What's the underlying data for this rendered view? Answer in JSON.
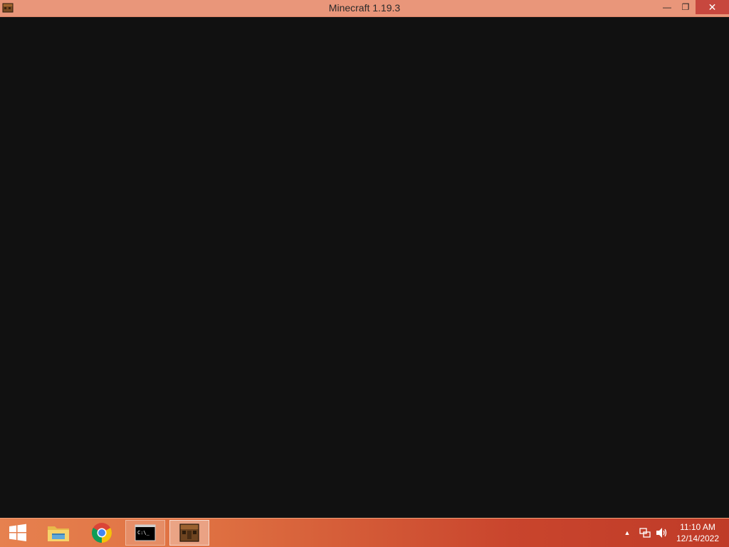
{
  "window": {
    "title": "Minecraft 1.19.3",
    "app_icon": "minecraft-crafting-table-icon",
    "controls": {
      "minimize_glyph": "—",
      "maximize_glyph": "❐",
      "close_glyph": "✕"
    }
  },
  "taskbar": {
    "items": [
      {
        "name": "start-button",
        "icon": "windows-logo-icon"
      },
      {
        "name": "file-explorer",
        "icon": "folder-icon"
      },
      {
        "name": "google-chrome",
        "icon": "chrome-icon"
      },
      {
        "name": "command-prompt",
        "icon": "cmd-icon",
        "icon_text": "C:\\_"
      },
      {
        "name": "minecraft",
        "icon": "minecraft-crafting-table-icon",
        "active": true
      }
    ],
    "tray": {
      "overflow_glyph": "▲",
      "network_icon": "network-icon",
      "volume_icon": "volume-icon"
    },
    "clock": {
      "time": "11:10 AM",
      "date": "12/14/2022"
    }
  },
  "colors": {
    "titlebar": "#e9967a",
    "close_button": "#c7473e",
    "window_content": "#111111",
    "taskbar_left": "#e6814f",
    "taskbar_right": "#bf3b28"
  }
}
